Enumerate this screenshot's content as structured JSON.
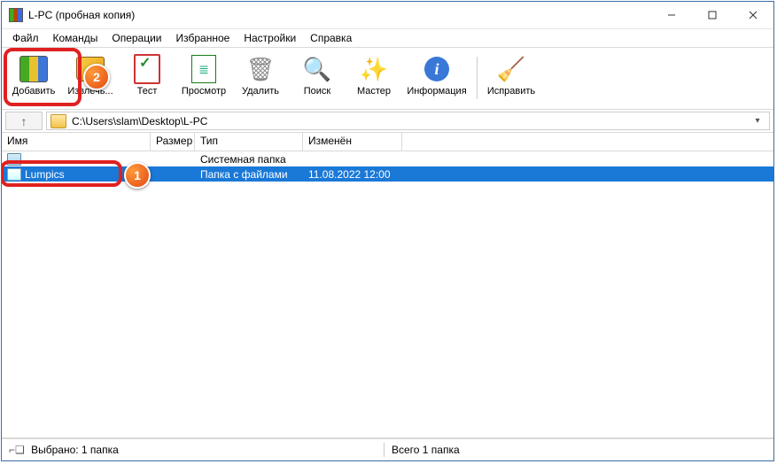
{
  "window": {
    "title": "L-PC (пробная копия)"
  },
  "menu": {
    "items": [
      "Файл",
      "Команды",
      "Операции",
      "Избранное",
      "Настройки",
      "Справка"
    ]
  },
  "toolbar": {
    "add": "Добавить",
    "extract": "Извлечь...",
    "test": "Тест",
    "view": "Просмотр",
    "delete": "Удалить",
    "find": "Поиск",
    "wizard": "Мастер",
    "info": "Информация",
    "repair": "Исправить"
  },
  "addr": {
    "path": "C:\\Users\\slam\\Desktop\\L-PC"
  },
  "columns": {
    "name": "Имя",
    "size": "Размер",
    "type": "Тип",
    "modified": "Изменён"
  },
  "rows": [
    {
      "name": "..",
      "size": "",
      "type": "Системная папка",
      "modified": ""
    },
    {
      "name": "Lumpics",
      "size": "",
      "type": "Папка с файлами",
      "modified": "11.08.2022 12:00"
    }
  ],
  "status": {
    "selected": "Выбрано: 1 папка",
    "total": "Всего 1 папка"
  },
  "annotations": {
    "badge1": "1",
    "badge2": "2"
  }
}
